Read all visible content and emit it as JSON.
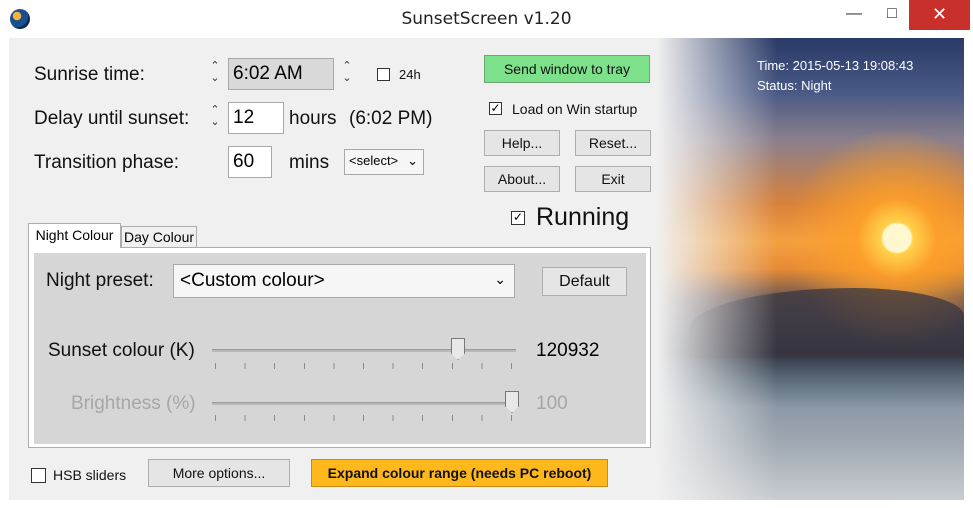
{
  "window": {
    "title": "SunsetScreen v1.20",
    "min_glyph": "—",
    "max_glyph": "□",
    "close_glyph": "✕"
  },
  "sunrise": {
    "label": "Sunrise time:",
    "value": "6:02 AM",
    "h24_label": "24h"
  },
  "delay": {
    "label": "Delay until sunset:",
    "value": "12",
    "unit": "hours",
    "sunset_time": "(6:02 PM)"
  },
  "transition": {
    "label": "Transition phase:",
    "value": "60",
    "unit": "mins",
    "select_value": "<select>"
  },
  "buttons": {
    "send_tray": "Send window to tray",
    "help": "Help...",
    "reset": "Reset...",
    "about": "About...",
    "exit": "Exit",
    "default": "Default",
    "more_options": "More options...",
    "expand_range": "Expand colour range (needs PC reboot)"
  },
  "checkboxes": {
    "load_on_startup": "Load on Win startup",
    "running": "Running",
    "hsb_sliders": "HSB sliders"
  },
  "status": {
    "time": "Time: 2015-05-13 19:08:43",
    "state": "Status: Night"
  },
  "tabs": [
    {
      "label": "Night Colour"
    },
    {
      "label": "Day Colour"
    }
  ],
  "night_preset": {
    "label": "Night preset:",
    "value": "<Custom colour>"
  },
  "sunset_colour": {
    "label": "Sunset colour (K)",
    "value": "120932",
    "slider_fraction": 0.82
  },
  "brightness": {
    "label": "Brightness (%)",
    "value": "100",
    "slider_fraction": 1.0
  },
  "colors": {
    "send_tray_bg": "#7de08a",
    "expand_bg": "#ffb81c",
    "close_bg": "#c7302b"
  }
}
